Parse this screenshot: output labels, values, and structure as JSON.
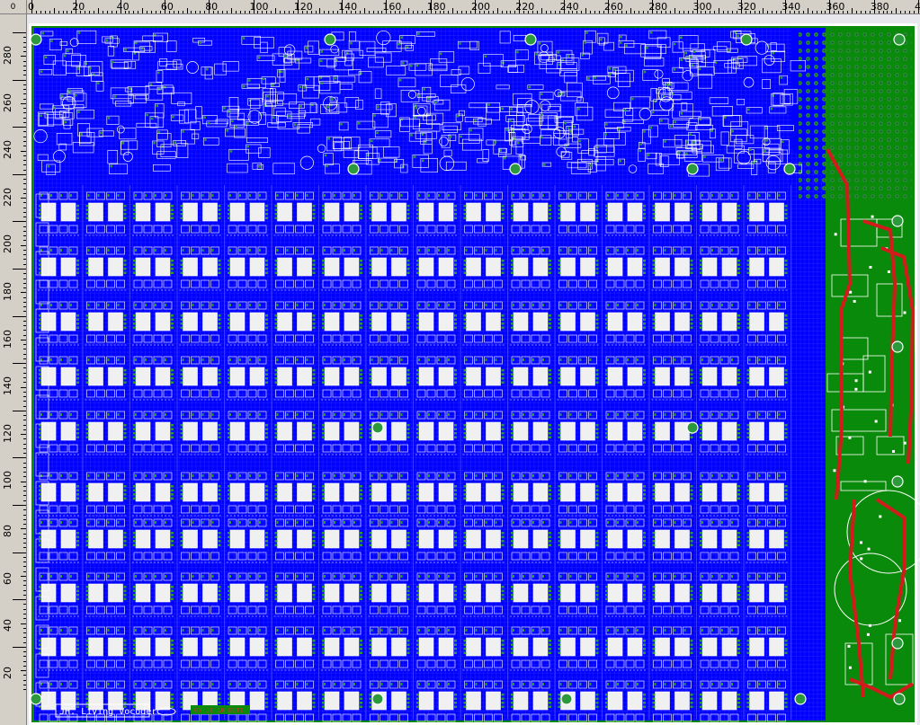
{
  "rulers": {
    "corner_label": "0",
    "top_ticks": [
      "0",
      "20",
      "40",
      "60",
      "80",
      "100",
      "120",
      "140",
      "160",
      "180",
      "200",
      "220",
      "240",
      "260",
      "280",
      "300",
      "320",
      "340",
      "360",
      "380",
      "400"
    ],
    "left_ticks": [
      "280",
      "260",
      "240",
      "220",
      "200",
      "180",
      "160",
      "140",
      "120",
      "100",
      "80",
      "60",
      "40",
      "20"
    ]
  },
  "board": {
    "project_caption": "JH. Living Vocoder",
    "copper_caption": "GY JE 1H EUTI",
    "colors": {
      "board_blue": "#0000ff",
      "board_green": "#0a8a0a",
      "trace_red": "#d21c1c",
      "silk_white": "#ffffff",
      "pad_green": "#2c9a3c",
      "grid_blue": "#1010ff"
    }
  }
}
